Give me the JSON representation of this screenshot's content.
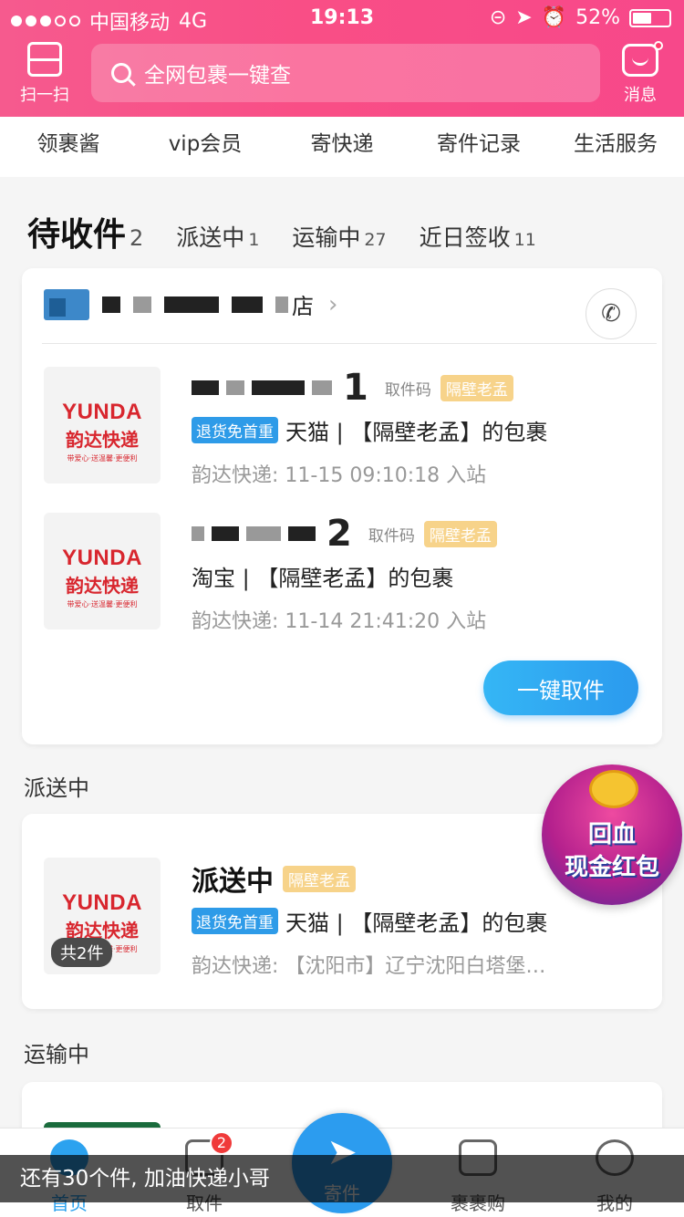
{
  "status": {
    "carrier": "中国移动",
    "network": "4G",
    "time": "19:13",
    "battery": "52%",
    "battery_level": 0.52
  },
  "header": {
    "scan_label": "扫一扫",
    "search_placeholder": "全网包裹一键查",
    "message_label": "消息"
  },
  "nav": [
    "领裹酱",
    "vip会员",
    "寄快递",
    "寄件记录",
    "生活服务"
  ],
  "tabs": [
    {
      "label": "待收件",
      "count": "2"
    },
    {
      "label": "派送中",
      "count": "1"
    },
    {
      "label": "运输中",
      "count": "27"
    },
    {
      "label": "近日签收",
      "count": "11"
    }
  ],
  "pickup_card": {
    "station_suffix": "店",
    "packages": [
      {
        "code_tail": "1",
        "code_label": "取件码",
        "tag": "隔壁老孟",
        "badge": "退货免首重",
        "shop": "天猫 | 【隔壁老孟】的包裹",
        "status": "韵达快递:  11-15 09:10:18 入站"
      },
      {
        "code_tail": "2",
        "code_label": "取件码",
        "tag": "隔壁老孟",
        "badge": "",
        "shop": "淘宝 | 【隔壁老孟】的包裹",
        "status": "韵达快递:  11-14 21:41:20 入站"
      }
    ],
    "onekey_label": "一键取件"
  },
  "courier_logo": {
    "brand": "YUNDA",
    "name": "韵达快递",
    "slogan": "带爱心·送温馨·更便利"
  },
  "delivering": {
    "section_title": "派送中",
    "title": "派送中",
    "tag": "隔壁老孟",
    "badge": "退货免首重",
    "shop": "天猫 | 【隔壁老孟】的包裹",
    "status": "韵达快递:  【沈阳市】辽宁沈阳白塔堡…",
    "count_pill": "共2件"
  },
  "transit": {
    "section_title": "运输中"
  },
  "promo": {
    "line1": "回血",
    "line2": "现金红包"
  },
  "tabbar": {
    "home": "首页",
    "pickup": "取件",
    "pickup_badge": "2",
    "send": "寄件",
    "shop": "裹裹购",
    "mine": "我的"
  },
  "toast": "还有30个件, 加油快递小哥",
  "colors": {
    "brand_pink": "#f94e86",
    "accent_blue": "#2c9cef",
    "tag_yellow": "#f7d38a",
    "yunda_red": "#d8262e"
  }
}
